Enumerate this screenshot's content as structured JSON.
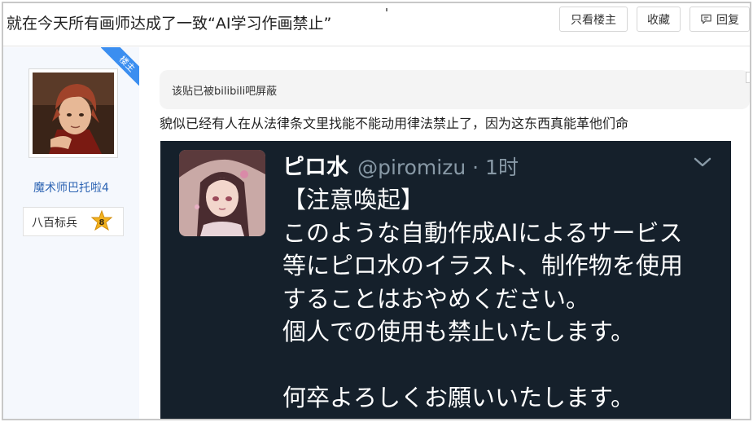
{
  "header": {
    "title": "就在今天所有画师达成了一致“AI学习作画禁止”",
    "buttons": {
      "only_op": "只看楼主",
      "favorite": "收藏",
      "reply": "回复"
    }
  },
  "author": {
    "op_badge": "楼主",
    "name": "魔术师巴托啦4",
    "level_name": "八百标兵",
    "level_number": "8"
  },
  "post": {
    "notice": "该贴已被bilibili吧屏蔽",
    "text": "貌似已经有人在从法律条文里找能不能动用律法禁止了，因为这东西真能革他们命"
  },
  "tweet": {
    "name": "ピロ水",
    "handle_time": "@piromizu · 1时",
    "lines": [
      "【注意喚起】",
      "このような自動作成AIによるサービス",
      "等にピロ水のイラスト、制作物を使用",
      "することはおやめください。",
      "個人での使用も禁止いたします。",
      "",
      "何卒よろしくお願いいたします。"
    ]
  },
  "colors": {
    "link_blue": "#2d64b3",
    "ribbon_blue": "#3b8ef0",
    "tweet_bg": "#15202b",
    "badge_gold": "#f2b21f"
  }
}
